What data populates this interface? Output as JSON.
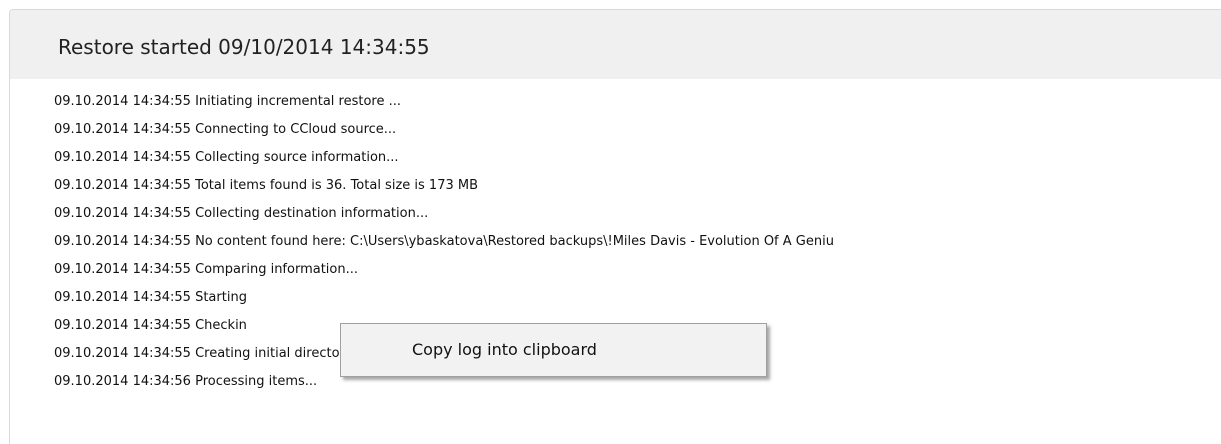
{
  "header": {
    "title": "Restore started 09/10/2014 14:34:55"
  },
  "log": {
    "lines": [
      "09.10.2014 14:34:55 Initiating incremental restore ...",
      "09.10.2014 14:34:55 Connecting to CCloud source...",
      "09.10.2014 14:34:55 Collecting source information...",
      "09.10.2014 14:34:55 Total items found is 36. Total size is 173 MB",
      "09.10.2014 14:34:55 Collecting destination information...",
      "09.10.2014 14:34:55 No content found here: C:\\Users\\ybaskatova\\Restored backups\\!Miles Davis - Evolution Of A Geniu",
      "09.10.2014 14:34:55 Comparing information...",
      "09.10.2014 14:34:55 Starting",
      "09.10.2014 14:34:55 Checkin",
      "09.10.2014 14:34:55 Creating initial directory structure...",
      "09.10.2014 14:34:56 Processing items..."
    ]
  },
  "context_menu": {
    "items": [
      {
        "label": "Copy log into clipboard"
      }
    ]
  }
}
